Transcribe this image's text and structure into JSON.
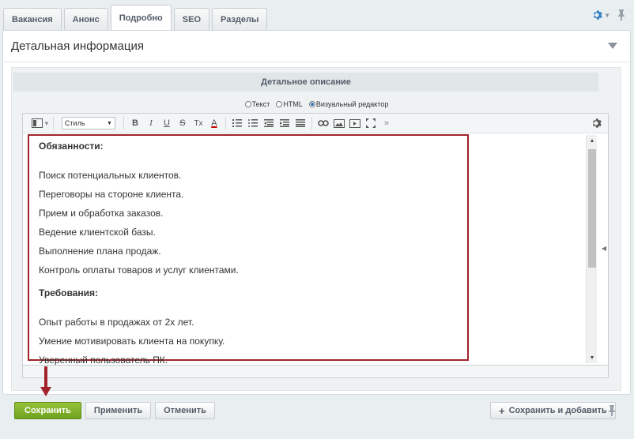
{
  "tabs": [
    {
      "label": "Вакансия"
    },
    {
      "label": "Анонс"
    },
    {
      "label": "Подробно"
    },
    {
      "label": "SEO"
    },
    {
      "label": "Разделы"
    }
  ],
  "panel": {
    "title": "Детальная информация",
    "section_title": "Детальное описание"
  },
  "modes": {
    "text": "Текст",
    "html": "HTML",
    "visual": "Визуальный редактор",
    "selected": "visual"
  },
  "toolbar": {
    "style_select": "Стиль",
    "bold": "B",
    "italic": "I",
    "underline": "U",
    "strike": "S",
    "clear_format": "Tx",
    "font_color": "A",
    "more": "»"
  },
  "content": {
    "heading1": "Обязанности:",
    "lines1": [
      "Поиск потенциальных клиентов.",
      "Переговоры на стороне клиента.",
      "Прием и обработка заказов.",
      "Ведение клиентской базы.",
      "Выполнение плана продаж.",
      "Контроль оплаты товаров и услуг клиентами."
    ],
    "heading2": "Требования:",
    "lines2": [
      "Опыт работы в продажах от 2х лет.",
      "Умение мотивировать клиента на покупку.",
      "Уверенный пользователь ПК."
    ]
  },
  "buttons": {
    "save": "Сохранить",
    "apply": "Применить",
    "cancel": "Отменить",
    "save_and_add": "Сохранить и добавить"
  },
  "colors": {
    "accent": "#6fa21f",
    "highlight_border": "#a0242a",
    "arrow": "#a0242a",
    "gear": "#2f7fc4"
  }
}
